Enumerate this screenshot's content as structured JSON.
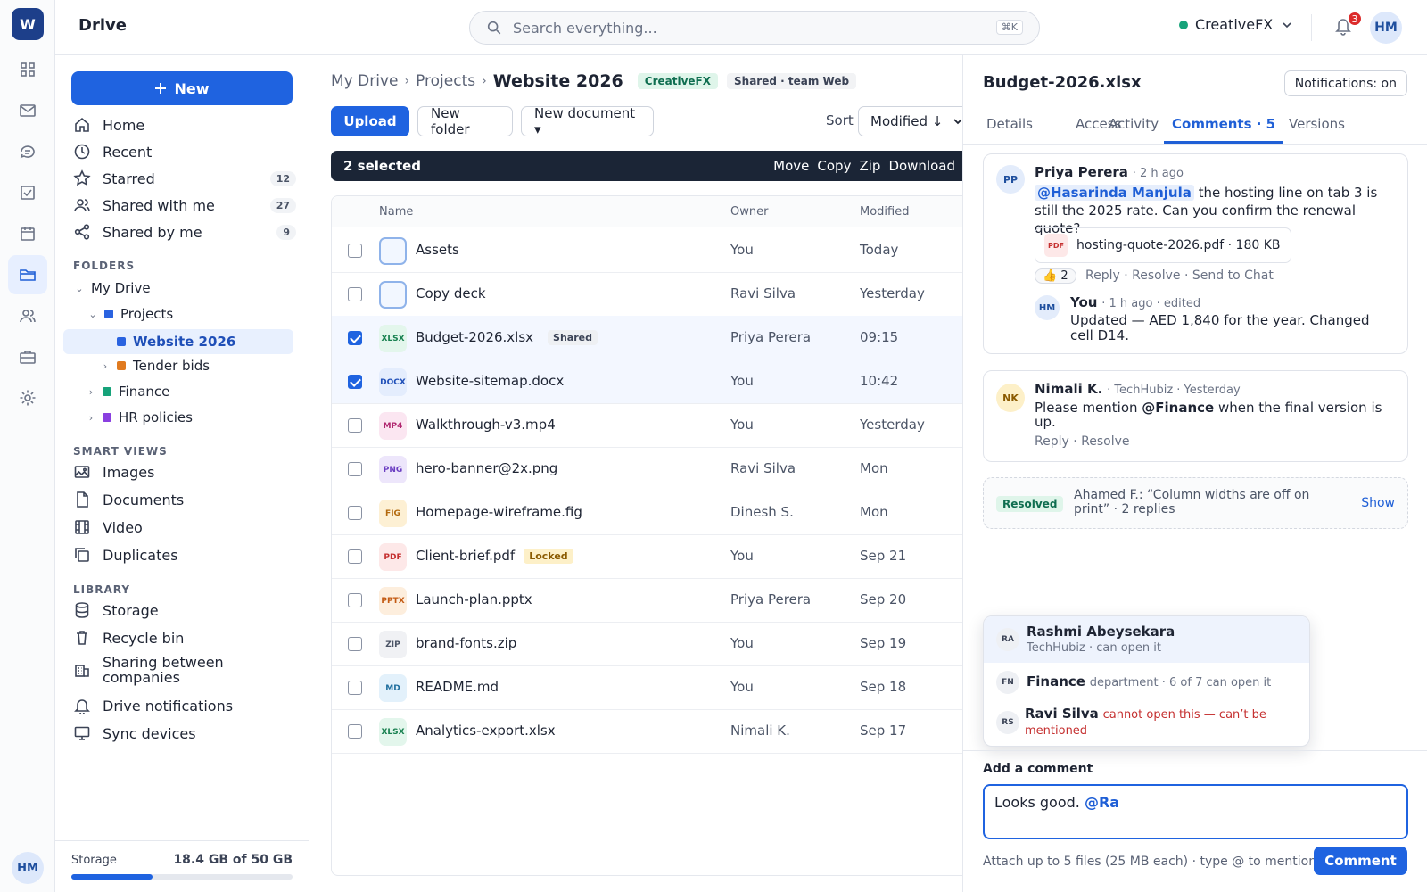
{
  "app": {
    "logo_letter": "W",
    "title": "Drive"
  },
  "search": {
    "placeholder": "Search everything...",
    "shortcut": "⌘K"
  },
  "workspace": {
    "name": "CreativeFX",
    "status_color": "#16a37a"
  },
  "notifications": {
    "count": "3"
  },
  "user": {
    "initials": "HM"
  },
  "rail": {
    "icons": [
      "apps-icon",
      "mail-icon",
      "chat-icon",
      "tasks-icon",
      "calendar-icon",
      "drive-icon",
      "people-icon",
      "briefcase-icon",
      "settings-icon"
    ],
    "active": "drive-icon"
  },
  "sidebar": {
    "new_label": "New",
    "nav": [
      {
        "label": "Home",
        "icon": "home-icon"
      },
      {
        "label": "Recent",
        "icon": "clock-icon"
      },
      {
        "label": "Starred",
        "icon": "star-icon",
        "count": "12"
      },
      {
        "label": "Shared with me",
        "icon": "users-icon",
        "count": "27"
      },
      {
        "label": "Shared by me",
        "icon": "share-icon",
        "count": "9"
      }
    ],
    "folders_label": "FOLDERS",
    "folders": {
      "my_drive": "My Drive",
      "projects": "Projects",
      "website": "Website 2026",
      "tender": "Tender bids",
      "finance": "Finance",
      "hr": "HR policies"
    },
    "smart_label": "SMART VIEWS",
    "smart": [
      {
        "label": "Images",
        "icon": "image-icon"
      },
      {
        "label": "Documents",
        "icon": "document-icon"
      },
      {
        "label": "Video",
        "icon": "film-icon"
      },
      {
        "label": "Duplicates",
        "icon": "copy-icon"
      }
    ],
    "library_label": "LIBRARY",
    "library": [
      {
        "label": "Storage",
        "icon": "database-icon"
      },
      {
        "label": "Recycle bin",
        "icon": "trash-icon"
      },
      {
        "label": "Sharing between companies",
        "icon": "building-icon"
      },
      {
        "label": "Drive notifications",
        "icon": "bell-icon"
      },
      {
        "label": "Sync devices",
        "icon": "monitor-icon"
      }
    ],
    "storage_label": "Storage",
    "storage_value": "18.4 GB of 50 GB",
    "storage_fraction": 0.368
  },
  "main": {
    "breadcrumb": [
      "My Drive",
      "Projects",
      "Website 2026"
    ],
    "badge_company": "CreativeFX",
    "badge_shared": "Shared · team Web",
    "upload": "Upload",
    "new_folder": "New folder",
    "new_document": "New document ▾",
    "sort_label": "Sort",
    "sort_value": "Modified ↓",
    "selection": {
      "count_label": "2 selected",
      "actions": [
        "Move",
        "Copy",
        "Zip",
        "Download"
      ]
    },
    "columns": {
      "name": "Name",
      "owner": "Owner",
      "modified": "Modified"
    },
    "files": [
      {
        "type": "folder",
        "name": "Assets",
        "owner": "You",
        "modified": "Today",
        "selected": false
      },
      {
        "type": "folder",
        "name": "Copy deck",
        "owner": "Ravi Silva",
        "modified": "Yesterday",
        "selected": false
      },
      {
        "type": "XLSX",
        "name": "Budget-2026.xlsx",
        "tag": "Shared",
        "owner": "Priya Perera",
        "modified": "09:15",
        "selected": true
      },
      {
        "type": "DOCX",
        "name": "Website-sitemap.docx",
        "owner": "You",
        "modified": "10:42",
        "selected": true
      },
      {
        "type": "MP4",
        "name": "Walkthrough-v3.mp4",
        "owner": "You",
        "modified": "Yesterday",
        "selected": false
      },
      {
        "type": "PNG",
        "name": "hero-banner@2x.png",
        "owner": "Ravi Silva",
        "modified": "Mon",
        "selected": false
      },
      {
        "type": "FIG",
        "name": "Homepage-wireframe.fig",
        "owner": "Dinesh S.",
        "modified": "Mon",
        "selected": false
      },
      {
        "type": "PDF",
        "name": "Client-brief.pdf",
        "tag": "Locked",
        "owner": "You",
        "modified": "Sep 21",
        "selected": false
      },
      {
        "type": "PPTX",
        "name": "Launch-plan.pptx",
        "owner": "Priya Perera",
        "modified": "Sep 20",
        "selected": false
      },
      {
        "type": "ZIP",
        "name": "brand-fonts.zip",
        "owner": "You",
        "modified": "Sep 19",
        "selected": false
      },
      {
        "type": "MD",
        "name": "README.md",
        "owner": "You",
        "modified": "Sep 18",
        "selected": false
      },
      {
        "type": "XLSX",
        "name": "Analytics-export.xlsx",
        "owner": "Nimali K.",
        "modified": "Sep 17",
        "selected": false
      }
    ]
  },
  "panel": {
    "title": "Budget-2026.xlsx",
    "notifications_btn": "Notifications: on",
    "tabs": [
      "Details",
      "Access",
      "Activity",
      "Comments · 5",
      "Versions"
    ],
    "active_tab": "Comments · 5",
    "comments": [
      {
        "initials": "PP",
        "author": "Priya Perera",
        "meta": "· 2 h ago",
        "mention": "@Hasarinda Manjula",
        "text": " the hosting line on tab 3 is still the 2025 rate. Can you confirm the renewal quote?",
        "attachment": "hosting-quote-2026.pdf · 180 KB",
        "reaction": "👍 2",
        "actions": "Reply · Resolve · Send to Chat",
        "reply": {
          "initials": "HM",
          "author": "You",
          "meta": "· 1 h ago · edited",
          "text": "Updated — AED 1,840 for the year. Changed cell D14."
        }
      },
      {
        "initials": "NK",
        "author": "Nimali K.",
        "meta": "· TechHubiz · Yesterday",
        "text_before": "Please mention ",
        "mention": "@Finance",
        "text_after": " when the final version is up.",
        "actions": "Reply · Resolve"
      }
    ],
    "resolved": {
      "tag": "Resolved",
      "text": "Ahamed F.: “Column widths are off on print” · 2 replies",
      "show": "Show"
    },
    "mention_options": [
      {
        "initials": "RA",
        "name": "Rashmi Abeysekara",
        "detail": "TechHubiz · can open it"
      },
      {
        "initials": "FN",
        "name": "Finance",
        "detail": "department · 6 of 7 can open it"
      },
      {
        "initials": "RS",
        "name": "Ravi Silva",
        "detail": "cannot open this — can’t be mentioned"
      }
    ],
    "add_label": "Add a comment",
    "draft_text": "Looks good. ",
    "draft_mention": "@Ra",
    "hint": "Attach up to 5 files (25 MB each) · type @ to mention",
    "submit": "Comment"
  }
}
